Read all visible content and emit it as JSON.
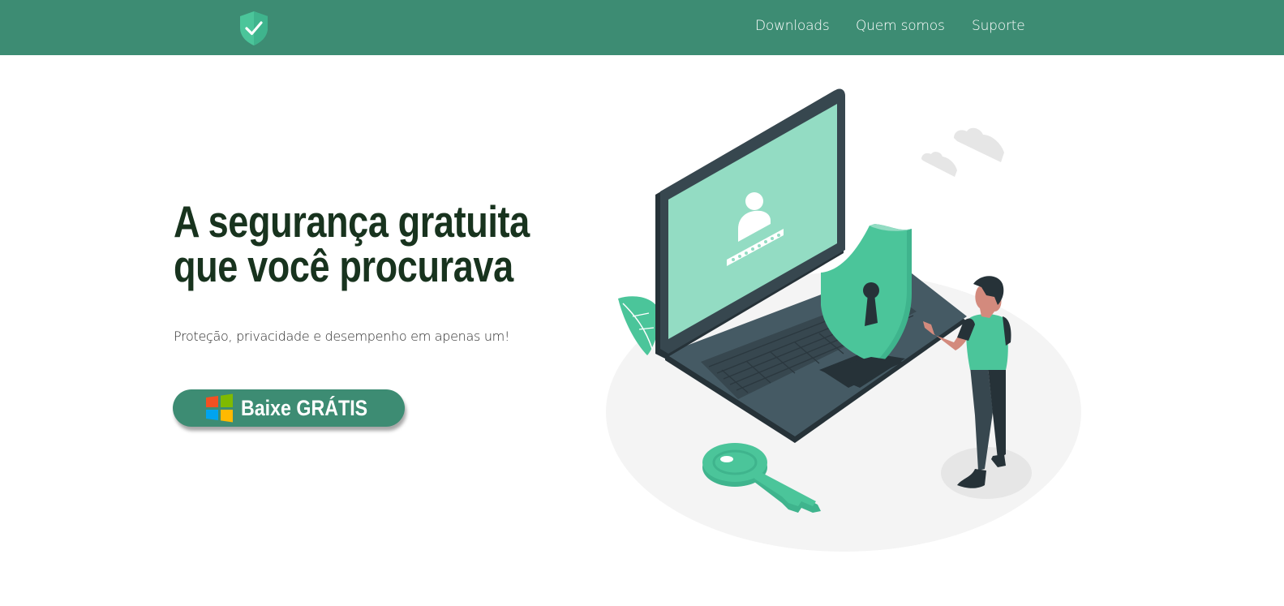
{
  "header": {
    "logo_icon": "shield-check-icon",
    "nav": [
      {
        "label": "Downloads"
      },
      {
        "label": "Quem somos"
      },
      {
        "label": "Suporte"
      }
    ]
  },
  "hero": {
    "title_line1": "A segurança gratuita",
    "title_line2": "que você procurava",
    "subtitle": "Proteção, privacidade e desempenho em apenas um!",
    "cta_label": "Baixe GRÁTIS",
    "cta_icon": "windows-logo-icon"
  },
  "illustration": {
    "name": "laptop-security-illustration"
  },
  "colors": {
    "brand": "#3d8c73",
    "accent": "#4bc59a",
    "title": "#18331e",
    "laptop": "#37474f"
  }
}
